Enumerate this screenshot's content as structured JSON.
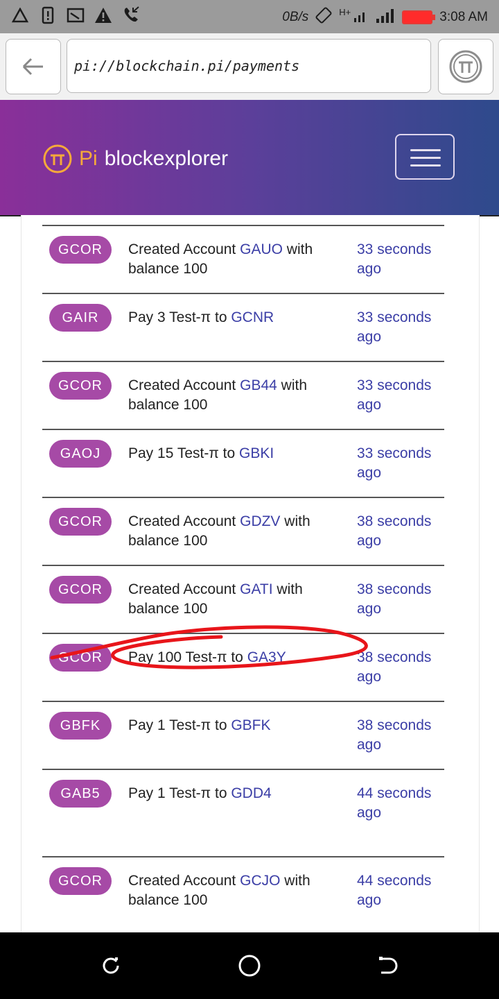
{
  "status_bar": {
    "data_rate": "0B/s",
    "network": "H+",
    "time": "3:08 AM"
  },
  "address_bar": {
    "url": "pi://blockchain.pi/payments"
  },
  "header": {
    "brand_symbol": "Pi",
    "brand_name": "blockexplorer"
  },
  "colors": {
    "badge": "#a64aa6",
    "link": "#3b3ea6",
    "annotation": "#e8151a"
  },
  "transactions": [
    {
      "account": "GCOR",
      "prefix": "Created Account ",
      "target": "GAUO",
      "suffix": " with balance 100",
      "time": "33 seconds ago"
    },
    {
      "account": "GAIR",
      "prefix": "Pay 3 Test-π to ",
      "target": "GCNR",
      "suffix": "",
      "time": "33 seconds ago"
    },
    {
      "account": "GCOR",
      "prefix": "Created Account ",
      "target": "GB44",
      "suffix": " with balance 100",
      "time": "33 seconds ago"
    },
    {
      "account": "GAOJ",
      "prefix": "Pay 15 Test-π to ",
      "target": "GBKI",
      "suffix": "",
      "time": "33 seconds ago"
    },
    {
      "account": "GCOR",
      "prefix": "Created Account ",
      "target": "GDZV",
      "suffix": " with balance 100",
      "time": "38 seconds ago"
    },
    {
      "account": "GCOR",
      "prefix": "Created Account ",
      "target": "GATI",
      "suffix": " with balance 100",
      "time": "38 seconds ago"
    },
    {
      "account": "GCOR",
      "prefix": "Pay 100 Test-π to ",
      "target": "GA3Y",
      "suffix": "",
      "time": "38 seconds ago"
    },
    {
      "account": "GBFK",
      "prefix": "Pay 1 Test-π to ",
      "target": "GBFK",
      "suffix": "",
      "time": "38 seconds ago"
    },
    {
      "account": "GAB5",
      "prefix": "Pay 1 Test-π to ",
      "target": "GDD4",
      "suffix": "",
      "time": "44 seconds ago"
    },
    {
      "account": "GCOR",
      "prefix": "Created Account ",
      "target": "GCJO",
      "suffix": " with balance 100",
      "time": "44 seconds ago"
    }
  ]
}
